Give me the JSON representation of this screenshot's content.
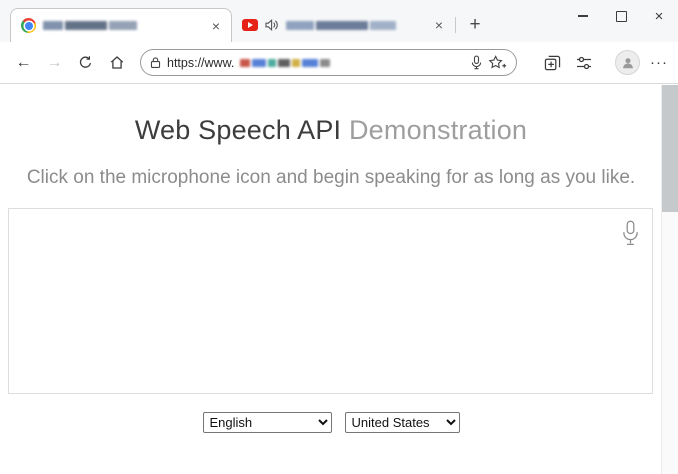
{
  "browser": {
    "window_controls": {
      "close_icon": "×"
    },
    "tabbar": {
      "new_tab_icon": "+",
      "tabs": [
        {
          "favicon": "chrome",
          "title_redacted": true,
          "close_icon": "×",
          "active": true
        },
        {
          "favicon": "youtube",
          "title_redacted": true,
          "audio_playing": true,
          "close_icon": "×",
          "active": false
        }
      ]
    },
    "navbar": {
      "back_icon": "←",
      "forward_icon": "→",
      "more_icon": "···",
      "address": {
        "url_prefix": "https://www.",
        "rest_redacted": true
      }
    }
  },
  "page": {
    "title": {
      "strong": "Web Speech API",
      "light": "Demonstration"
    },
    "instructions": "Click on the microphone icon and begin speaking for as long as you like.",
    "language_select": {
      "value": "English"
    },
    "dialect_select": {
      "value": "United States"
    }
  },
  "colors": {
    "youtube_red": "#e62117",
    "chrome_blue": "#4285f4",
    "title_strong": "#3d3d3d",
    "title_light": "#9e9e9e"
  }
}
